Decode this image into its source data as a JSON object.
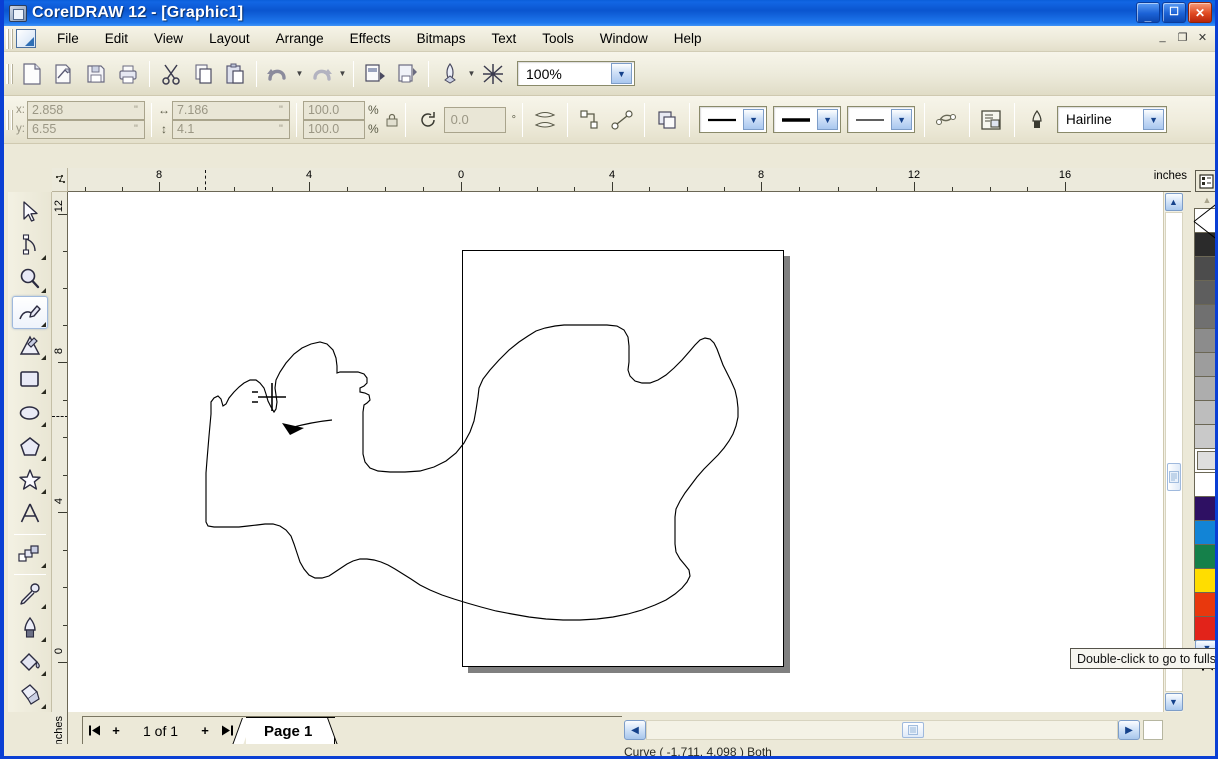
{
  "window": {
    "title": "CoreIDRAW 12 - [Graphic1]",
    "app_icon": "coreldraw-app-icon",
    "controls": [
      {
        "name": "minimize",
        "glyph": "_"
      },
      {
        "name": "maximize",
        "glyph": "❐"
      },
      {
        "name": "close",
        "glyph": "✕"
      }
    ],
    "mdi_controls": [
      {
        "name": "mdi-minimize",
        "glyph": "_"
      },
      {
        "name": "mdi-restore",
        "glyph": "❐"
      },
      {
        "name": "mdi-close",
        "glyph": "✕"
      }
    ]
  },
  "menubar": {
    "items": [
      {
        "label": "File",
        "accel": "F"
      },
      {
        "label": "Edit",
        "accel": "E"
      },
      {
        "label": "View",
        "accel": "V"
      },
      {
        "label": "Layout",
        "accel": "L"
      },
      {
        "label": "Arrange",
        "accel": "A"
      },
      {
        "label": "Effects",
        "accel": "c"
      },
      {
        "label": "Bitmaps",
        "accel": "B"
      },
      {
        "label": "Text",
        "accel": "T"
      },
      {
        "label": "Tools",
        "accel": "o"
      },
      {
        "label": "Window",
        "accel": "W"
      },
      {
        "label": "Help",
        "accel": "H"
      }
    ]
  },
  "toolbar": {
    "buttons": [
      {
        "name": "new-icon",
        "tip": "New"
      },
      {
        "name": "open-icon",
        "tip": "Open"
      },
      {
        "name": "save-icon",
        "tip": "Save"
      },
      {
        "name": "print-icon",
        "tip": "Print"
      },
      {
        "name": "cut-icon",
        "tip": "Cut"
      },
      {
        "name": "copy-icon",
        "tip": "Copy"
      },
      {
        "name": "paste-icon",
        "tip": "Paste"
      },
      {
        "name": "undo-icon",
        "tip": "Undo"
      },
      {
        "name": "redo-icon",
        "tip": "Redo"
      },
      {
        "name": "import-icon",
        "tip": "Import"
      },
      {
        "name": "export-icon",
        "tip": "Export"
      },
      {
        "name": "app-launcher-icon",
        "tip": "Application Launcher"
      },
      {
        "name": "corel-online-icon",
        "tip": "Corel Online"
      }
    ],
    "zoom_level": "100%"
  },
  "propertybar": {
    "x_label": "x:",
    "y_label": "y:",
    "x_value": "2.858",
    "y_value": "6.55",
    "unit": "\"",
    "width_value": "7.186",
    "height_value": "4.1",
    "scale_h": "100.0",
    "scale_v": "100.0",
    "percent": "%",
    "lock_icon": "lock-ratio-icon",
    "rotation": "0.0",
    "degree": "°",
    "outline_width": "Hairline",
    "buttons": [
      {
        "name": "mirror-horizontal-icon"
      },
      {
        "name": "mirror-vertical-icon"
      },
      {
        "name": "to-curves-icon"
      },
      {
        "name": "convert-line-icon"
      },
      {
        "name": "wrap-text-icon"
      },
      {
        "name": "convert-outline-icon"
      },
      {
        "name": "object-properties-icon"
      }
    ]
  },
  "rulers": {
    "units": "inches",
    "horizontal_labels": [
      "8",
      "4",
      "0",
      "4",
      "8",
      "12",
      "16"
    ],
    "vertical_labels": [
      "12",
      "8",
      "4",
      "0"
    ]
  },
  "toolbox": {
    "tools": [
      {
        "name": "pick-tool",
        "label": "Pick",
        "flyout": false,
        "active": false
      },
      {
        "name": "shape-tool",
        "label": "Shape",
        "flyout": true,
        "active": false
      },
      {
        "name": "zoom-tool",
        "label": "Zoom",
        "flyout": true,
        "active": false
      },
      {
        "name": "freehand-tool",
        "label": "Freehand",
        "flyout": true,
        "active": true
      },
      {
        "name": "smart-drawing-tool",
        "label": "Smart Drawing",
        "flyout": true,
        "active": false
      },
      {
        "name": "rectangle-tool",
        "label": "Rectangle",
        "flyout": true,
        "active": false
      },
      {
        "name": "ellipse-tool",
        "label": "Ellipse",
        "flyout": true,
        "active": false
      },
      {
        "name": "polygon-tool",
        "label": "Polygon",
        "flyout": true,
        "active": false
      },
      {
        "name": "star-tool",
        "label": "Star",
        "flyout": true,
        "active": false
      },
      {
        "name": "text-tool",
        "label": "Text",
        "flyout": false,
        "active": false
      },
      {
        "name": "interactive-blend-tool",
        "label": "Interactive Blend",
        "flyout": true,
        "active": false
      },
      {
        "name": "eyedropper-tool",
        "label": "Eyedropper",
        "flyout": true,
        "active": false
      },
      {
        "name": "outline-pen-tool",
        "label": "Outline",
        "flyout": true,
        "active": false
      },
      {
        "name": "fill-tool",
        "label": "Fill",
        "flyout": true,
        "active": false
      },
      {
        "name": "interactive-fill-tool",
        "label": "Interactive Fill",
        "flyout": true,
        "active": false
      }
    ]
  },
  "canvas": {
    "cursor": "freehand-crosshair-cursor",
    "shape_description": "hand-drawn freehand closed outline"
  },
  "pagenav": {
    "first_glyph": "⏮",
    "add_left_glyph": "+",
    "count_label": "1 of 1",
    "add_right_glyph": "+",
    "last_glyph": "⏭",
    "tab_label": "Page 1"
  },
  "palette": {
    "scroll_up": "▲",
    "scroll_down": "▼",
    "home_glyph": "⏮",
    "swatches": [
      {
        "name": "no-color",
        "hex": "none"
      },
      {
        "name": "black",
        "hex": "#2b2b2b"
      },
      {
        "name": "gray-90",
        "hex": "#4c4c4c"
      },
      {
        "name": "gray-80",
        "hex": "#5e5e5e"
      },
      {
        "name": "gray-70",
        "hex": "#707070"
      },
      {
        "name": "gray-60",
        "hex": "#8c8c8c"
      },
      {
        "name": "gray-50",
        "hex": "#9d9d9d"
      },
      {
        "name": "gray-40",
        "hex": "#adadad"
      },
      {
        "name": "gray-30",
        "hex": "#bdbdbd"
      },
      {
        "name": "gray-20",
        "hex": "#c9c9c9"
      },
      {
        "name": "gray-10",
        "hex": "#dedede"
      },
      {
        "name": "white",
        "hex": "#ffffff"
      },
      {
        "name": "dark-violet",
        "hex": "#2e1063"
      },
      {
        "name": "blue",
        "hex": "#1284d6"
      },
      {
        "name": "green",
        "hex": "#15804a"
      },
      {
        "name": "yellow",
        "hex": "#ffdd00"
      },
      {
        "name": "orange-red",
        "hex": "#e8380d"
      },
      {
        "name": "red",
        "hex": "#e2231a"
      }
    ]
  },
  "tooltip": {
    "text": "Double-click to go to fullsc"
  },
  "statusbar": {
    "text": "Curve  ( -1.711, 4.098 )  Both"
  },
  "colors": {
    "title_blue": "#0a55cf",
    "chrome": "#ece9d8",
    "accent": "#15428b"
  }
}
